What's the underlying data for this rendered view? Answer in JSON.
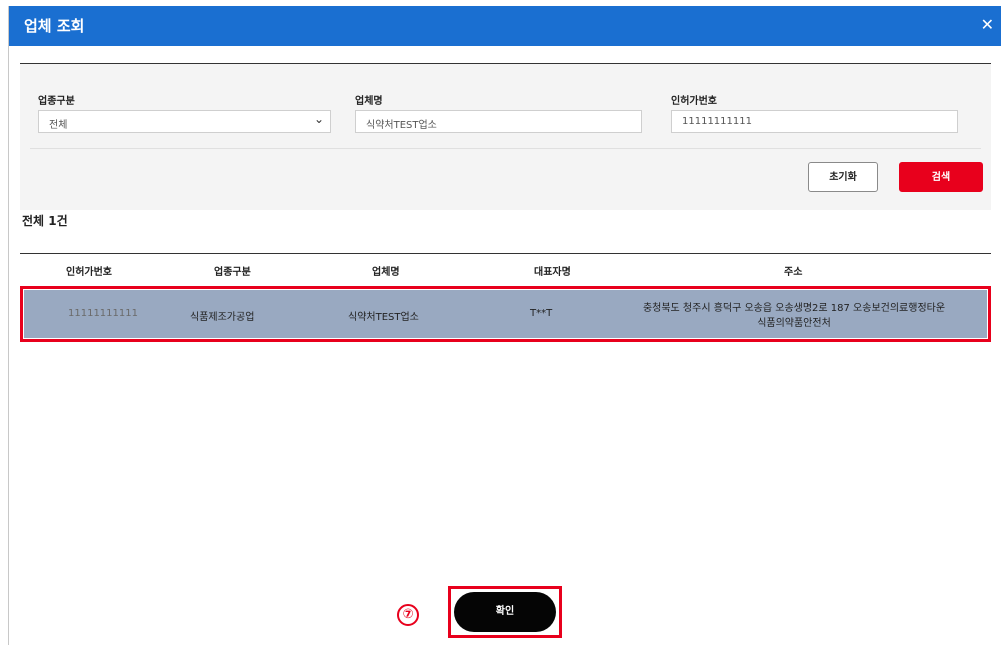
{
  "dialog": {
    "title": "업체 조회",
    "close_glyph": "✕"
  },
  "search": {
    "category_label": "업종구분",
    "category_value": "전체",
    "name_label": "업체명",
    "name_value": "식약처TEST업소",
    "license_label": "인허가번호",
    "license_value": "11111111111",
    "reset_label": "초기화",
    "search_label": "검색"
  },
  "results": {
    "count_text": "전체 1건",
    "columns": [
      "인허가번호",
      "업종구분",
      "업체명",
      "대표자명",
      "주소"
    ],
    "rows": [
      {
        "license": "11111111111",
        "category": "식품제조가공업",
        "name": "식약처TEST업소",
        "representative": "T**T",
        "address_line1": "충청북도 청주시 흥덕구 오송읍 오송생명2로 187 오송보건의료행정타운",
        "address_line2": "식품의약품안전처"
      }
    ]
  },
  "footer": {
    "step_marker": "⑦",
    "confirm_label": "확인"
  },
  "colors": {
    "title_bar": "#1a6fd1",
    "accent_red": "#e8001c",
    "selected_row": "#99a9c1",
    "confirm_btn": "#050505"
  }
}
